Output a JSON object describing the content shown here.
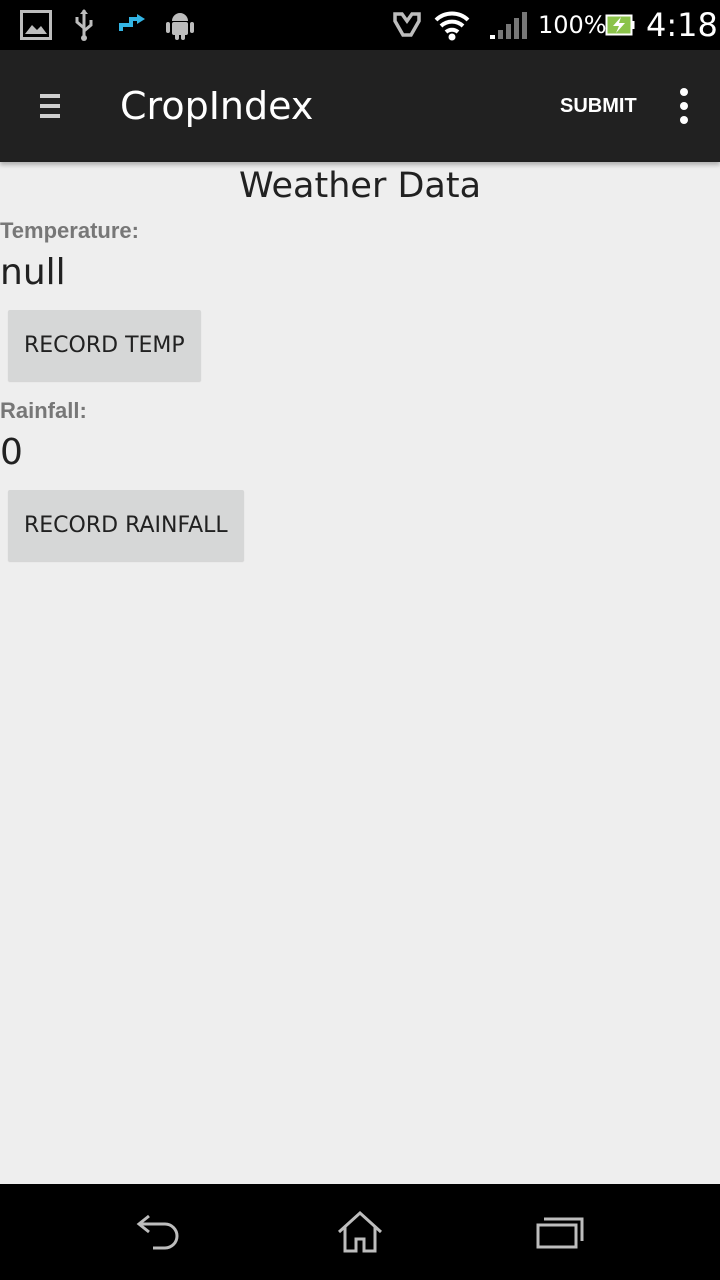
{
  "status_bar": {
    "battery_percent": "100%",
    "time": "4:18",
    "icons": [
      "gallery-icon",
      "usb-icon",
      "sync-icon",
      "android-icon",
      "nfc-icon",
      "wifi-icon",
      "signal-icon",
      "battery-charging-icon"
    ]
  },
  "action_bar": {
    "title": "CropIndex",
    "submit_label": "SUBMIT",
    "menu_icon": "hamburger-menu-icon",
    "overflow_icon": "overflow-menu-icon"
  },
  "content": {
    "title": "Weather Data",
    "temperature": {
      "label": "Temperature:",
      "value": "null",
      "button_label": "RECORD TEMP"
    },
    "rainfall": {
      "label": "Rainfall:",
      "value": "0",
      "button_label": "RECORD RAINFALL"
    }
  },
  "nav_bar": {
    "icons": [
      "back-icon",
      "home-icon",
      "recent-apps-icon"
    ]
  },
  "colors": {
    "status_bar": "#000000",
    "action_bar": "#212121",
    "background": "#eeeeee",
    "button": "#d6d7d7",
    "label": "#777777",
    "sync_icon": "#33b5e5",
    "battery_fill": "#8bc34a"
  }
}
